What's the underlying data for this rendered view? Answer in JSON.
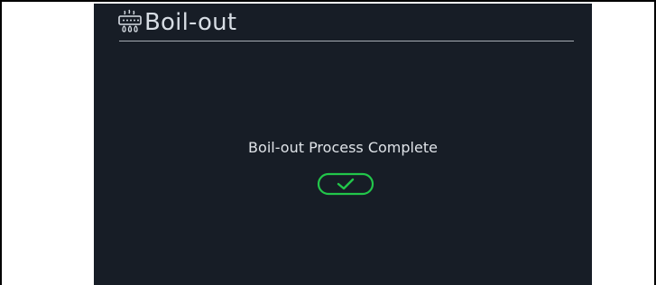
{
  "screen": {
    "title": "Boil-out",
    "title_icon": "fryer-boil-icon",
    "message": "Boil-out Process Complete",
    "confirm_icon": "checkmark-icon",
    "colors": {
      "background": "#171d26",
      "title_text": "#d7dde4",
      "message_text": "#dfe3e8",
      "rule": "#a6acb4",
      "accent_green": "#22c64a"
    }
  }
}
